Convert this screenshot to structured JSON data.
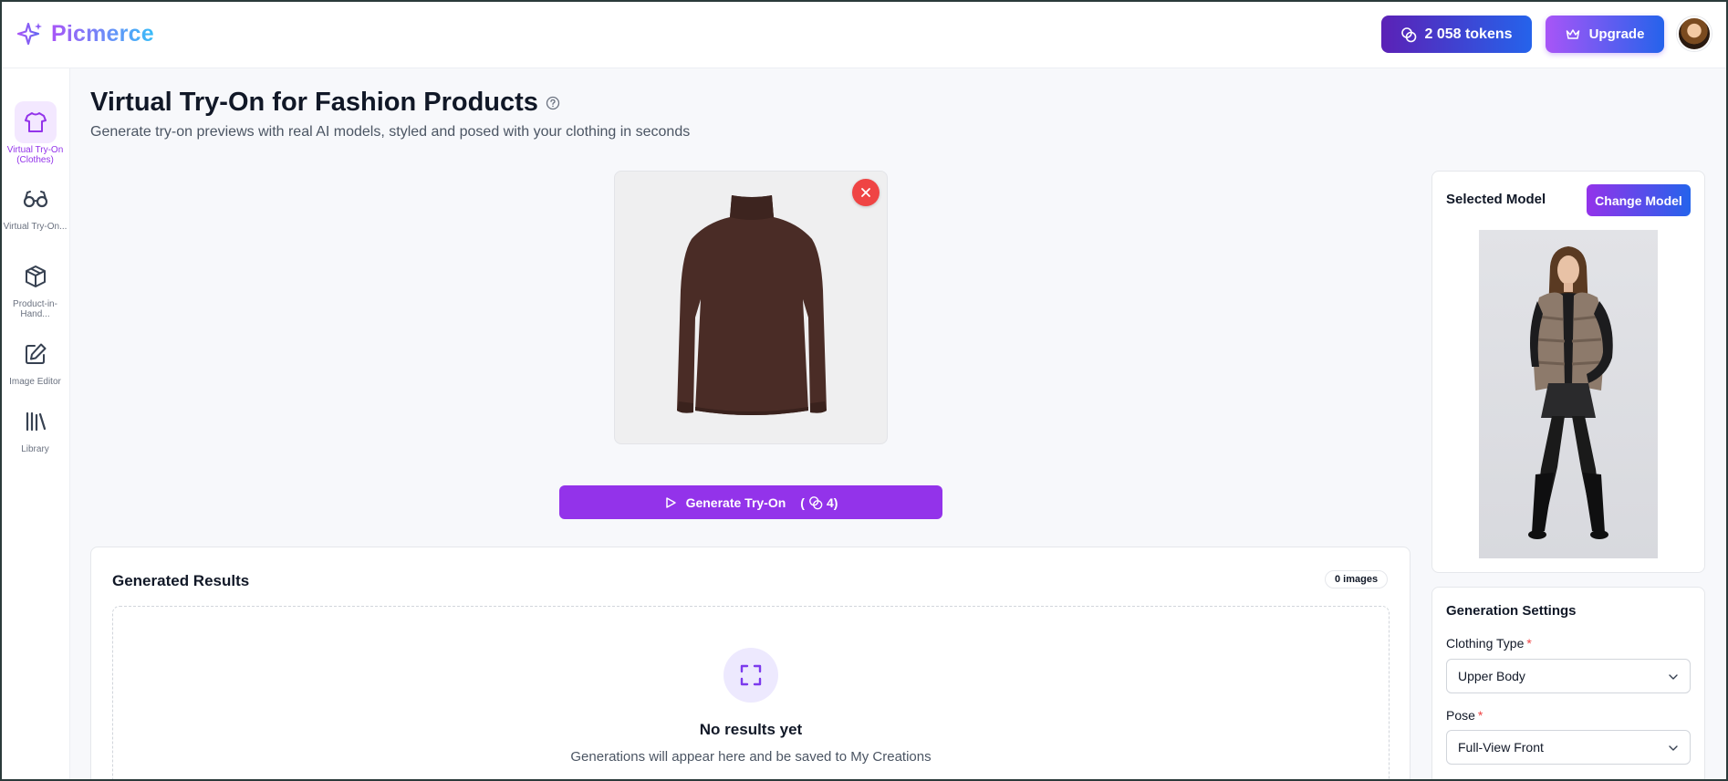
{
  "header": {
    "brand": "Picmerce",
    "tokens_label": "2 058 tokens",
    "upgrade_label": "Upgrade"
  },
  "sidebar": {
    "items": [
      {
        "label": "Virtual Try-On (Clothes)",
        "icon": "shirt-icon",
        "active": true
      },
      {
        "label": "Virtual Try-On...",
        "icon": "glasses-icon",
        "active": false
      },
      {
        "label": "Product-in-Hand...",
        "icon": "box-icon",
        "active": false
      },
      {
        "label": "Image Editor",
        "icon": "edit-icon",
        "active": false
      },
      {
        "label": "Library",
        "icon": "library-icon",
        "active": false
      }
    ]
  },
  "main": {
    "title": "Virtual Try-On for Fashion Products",
    "subtitle": "Generate try-on previews with real AI models, styled and posed with your clothing in seconds",
    "generate_label": "Generate Try-On",
    "generate_cost": "(",
    "generate_cost_value": "4)"
  },
  "results": {
    "title": "Generated Results",
    "count": "0 images",
    "empty_title": "No results yet",
    "empty_sub": "Generations will appear here and be saved to My Creations"
  },
  "model": {
    "title": "Selected Model",
    "change_label": "Change Model"
  },
  "settings": {
    "title": "Generation Settings",
    "clothing_type_label": "Clothing Type",
    "clothing_type_value": "Upper Body",
    "pose_label": "Pose",
    "pose_value": "Full-View Front",
    "required_mark": "*"
  },
  "colors": {
    "accent": "#9333ea",
    "accent_blue": "#2563eb",
    "danger": "#ef4444"
  }
}
